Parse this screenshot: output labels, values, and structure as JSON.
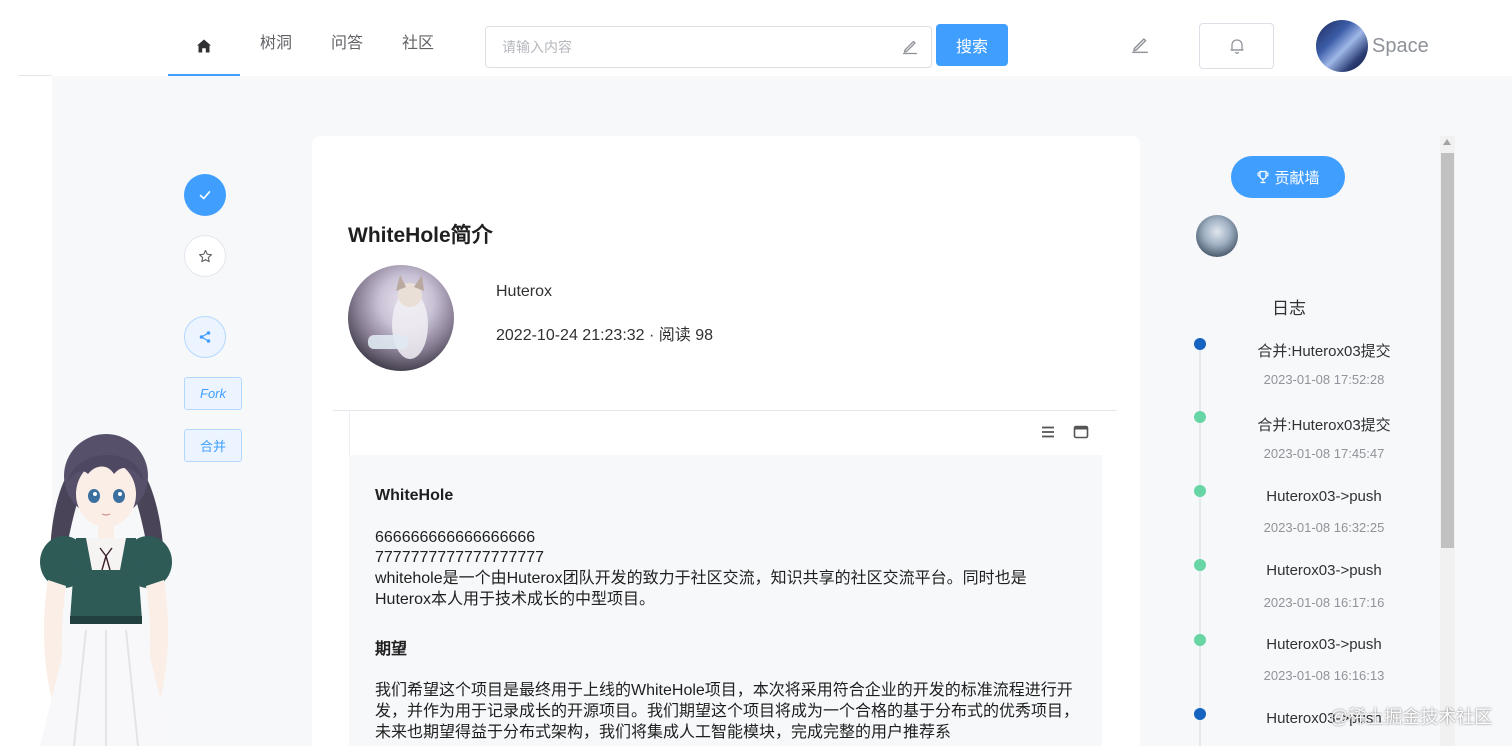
{
  "nav": {
    "home_icon": "home-icon",
    "items": [
      "树洞",
      "问答",
      "社区"
    ]
  },
  "search": {
    "placeholder": "请输入内容",
    "button_label": "搜索"
  },
  "header": {
    "write_icon": "edit-pen-icon",
    "bell_icon": "bell-icon",
    "user_name": "Space"
  },
  "actions": {
    "fork_label": "Fork",
    "merge_label": "合并"
  },
  "article": {
    "title": "WhiteHole简介",
    "author": "Huterox",
    "meta": "2022-10-24 21:23:32 · 阅读 98",
    "heading1": "WhiteHole",
    "line1": "666666666666666666",
    "line2": "7777777777777777777",
    "para1": "whitehole是一个由Huterox团队开发的致力于社区交流，知识共享的社区交流平台。同时也是Huterox本人用于技术成长的中型项目。",
    "heading2": "期望",
    "para2": "我们希望这个项目是最终用于上线的WhiteHole项目，本次将采用符合企业的开发的标准流程进行开发，并作为用于记录成长的开源项目。我们期望这个项目将成为一个合格的基于分布式的优秀项目，未来也期望得益于分布式架构，我们将集成人工智能模块，完成完整的用户推荐系"
  },
  "sidebar": {
    "contrib_label": "贡献墙",
    "log_title": "日志",
    "timeline": [
      {
        "message": "合并:Huterox03提交",
        "time": "2023-01-08 17:52:28",
        "color": "#1565c0"
      },
      {
        "message": "合并:Huterox03提交",
        "time": "2023-01-08 17:45:47",
        "color": "#67d6a4"
      },
      {
        "message": "Huterox03->push",
        "time": "2023-01-08 16:32:25",
        "color": "#67d6a4"
      },
      {
        "message": "Huterox03->push",
        "time": "2023-01-08 16:17:16",
        "color": "#67d6a4"
      },
      {
        "message": "Huterox03->push",
        "time": "2023-01-08 16:16:13",
        "color": "#67d6a4"
      },
      {
        "message": "Huterox03->push",
        "time": "",
        "color": "#1565c0"
      }
    ]
  },
  "watermark": "@稀土掘金技术社区",
  "colors": {
    "accent": "#409eff",
    "background": "#f7f8fa"
  }
}
